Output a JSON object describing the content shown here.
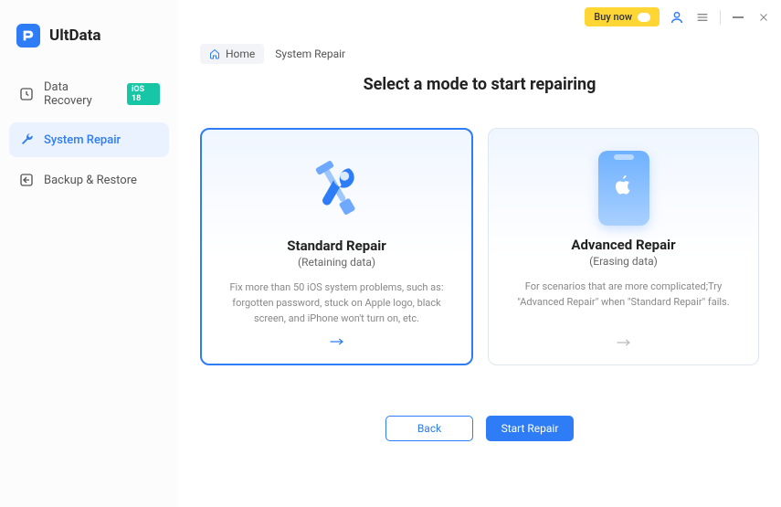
{
  "app": {
    "name": "UltData"
  },
  "titlebar": {
    "buy_label": "Buy now"
  },
  "sidebar": {
    "items": [
      {
        "label": "Data Recovery",
        "badge": "iOS 18"
      },
      {
        "label": "System Repair"
      },
      {
        "label": "Backup & Restore"
      }
    ]
  },
  "breadcrumb": {
    "home_label": "Home",
    "current": "System Repair"
  },
  "page": {
    "title": "Select a mode to start repairing"
  },
  "cards": {
    "standard": {
      "title": "Standard Repair",
      "subtitle": "(Retaining data)",
      "desc": "Fix more than 50 iOS system problems, such as: forgotten password, stuck on Apple logo, black screen, and iPhone won't turn on, etc."
    },
    "advanced": {
      "title": "Advanced Repair",
      "subtitle": "(Erasing data)",
      "desc": "For scenarios that are more complicated;Try \"Advanced Repair\" when \"Standard Repair\" fails."
    }
  },
  "buttons": {
    "back": "Back",
    "start": "Start Repair"
  }
}
